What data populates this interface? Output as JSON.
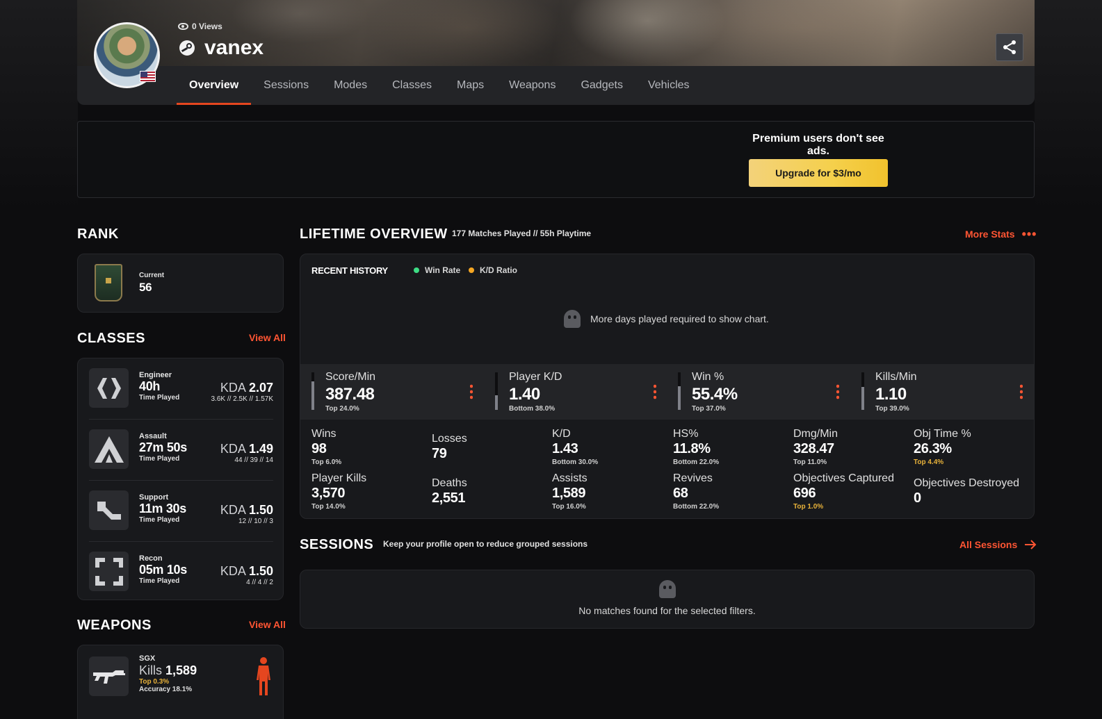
{
  "header": {
    "views": "0 Views",
    "player_name": "vanex",
    "tabs": [
      "Overview",
      "Sessions",
      "Modes",
      "Classes",
      "Maps",
      "Weapons",
      "Gadgets",
      "Vehicles"
    ],
    "active_tab": "Overview"
  },
  "ad": {
    "text": "Premium users don't see ads.",
    "button": "Upgrade for $3/mo"
  },
  "rank": {
    "title": "RANK",
    "label": "Current",
    "value": "56"
  },
  "classes": {
    "title": "CLASSES",
    "view_all": "View All",
    "time_label": "Time Played",
    "kda_label": "KDA",
    "items": [
      {
        "name": "Engineer",
        "time": "40h",
        "kda": "2.07",
        "detail": "3.6K // 2.5K // 1.57K",
        "icon": "engineer-icon"
      },
      {
        "name": "Assault",
        "time": "27m 50s",
        "kda": "1.49",
        "detail": "44 // 39 // 14",
        "icon": "assault-icon"
      },
      {
        "name": "Support",
        "time": "11m 30s",
        "kda": "1.50",
        "detail": "12 // 10 // 3",
        "icon": "support-icon"
      },
      {
        "name": "Recon",
        "time": "05m 10s",
        "kda": "1.50",
        "detail": "4 // 4 // 2",
        "icon": "recon-icon"
      }
    ]
  },
  "weapons": {
    "title": "WEAPONS",
    "view_all": "View All",
    "items": [
      {
        "name": "SGX",
        "kills_label": "Kills",
        "kills": "1,589",
        "rank": "Top 0.3%",
        "accuracy": "Accuracy 18.1%"
      }
    ]
  },
  "lifetime": {
    "title": "LIFETIME OVERVIEW",
    "subtitle": "177 Matches Played // 55h Playtime",
    "more_stats": "More Stats",
    "recent_history": "RECENT HISTORY",
    "legend": [
      {
        "label": "Win Rate",
        "color": "#3ddc84"
      },
      {
        "label": "K/D Ratio",
        "color": "#f5a623"
      }
    ],
    "chart_empty": "More days played required to show chart.",
    "top_stats": [
      {
        "label": "Score/Min",
        "value": "387.48",
        "rank": "Top 24.0%",
        "level": 0.76
      },
      {
        "label": "Player K/D",
        "value": "1.40",
        "rank": "Bottom 38.0%",
        "level": 0.38
      },
      {
        "label": "Win %",
        "value": "55.4%",
        "rank": "Top 37.0%",
        "level": 0.63
      },
      {
        "label": "Kills/Min",
        "value": "1.10",
        "rank": "Top 39.0%",
        "level": 0.61
      }
    ],
    "grid_stats": [
      {
        "label": "Wins",
        "value": "98",
        "rank": "Top 6.0%"
      },
      {
        "label": "Losses",
        "value": "79",
        "rank": ""
      },
      {
        "label": "K/D",
        "value": "1.43",
        "rank": "Bottom 30.0%"
      },
      {
        "label": "HS%",
        "value": "11.8%",
        "rank": "Bottom 22.0%"
      },
      {
        "label": "Dmg/Min",
        "value": "328.47",
        "rank": "Top 11.0%"
      },
      {
        "label": "Obj Time %",
        "value": "26.3%",
        "rank": "Top 4.4%",
        "gold": true
      },
      {
        "label": "Player Kills",
        "value": "3,570",
        "rank": "Top 14.0%"
      },
      {
        "label": "Deaths",
        "value": "2,551",
        "rank": ""
      },
      {
        "label": "Assists",
        "value": "1,589",
        "rank": "Top 16.0%"
      },
      {
        "label": "Revives",
        "value": "68",
        "rank": "Bottom 22.0%"
      },
      {
        "label": "Objectives Captured",
        "value": "696",
        "rank": "Top 1.0%",
        "gold": true
      },
      {
        "label": "Objectives Destroyed",
        "value": "0",
        "rank": ""
      }
    ]
  },
  "sessions": {
    "title": "SESSIONS",
    "subtitle": "Keep your profile open to reduce grouped sessions",
    "all_sessions": "All Sessions",
    "empty": "No matches found for the selected filters."
  },
  "colors": {
    "accent": "#ff5533",
    "gold": "#e8b23a",
    "background": "#0d0d0f",
    "card": "#18191c"
  }
}
